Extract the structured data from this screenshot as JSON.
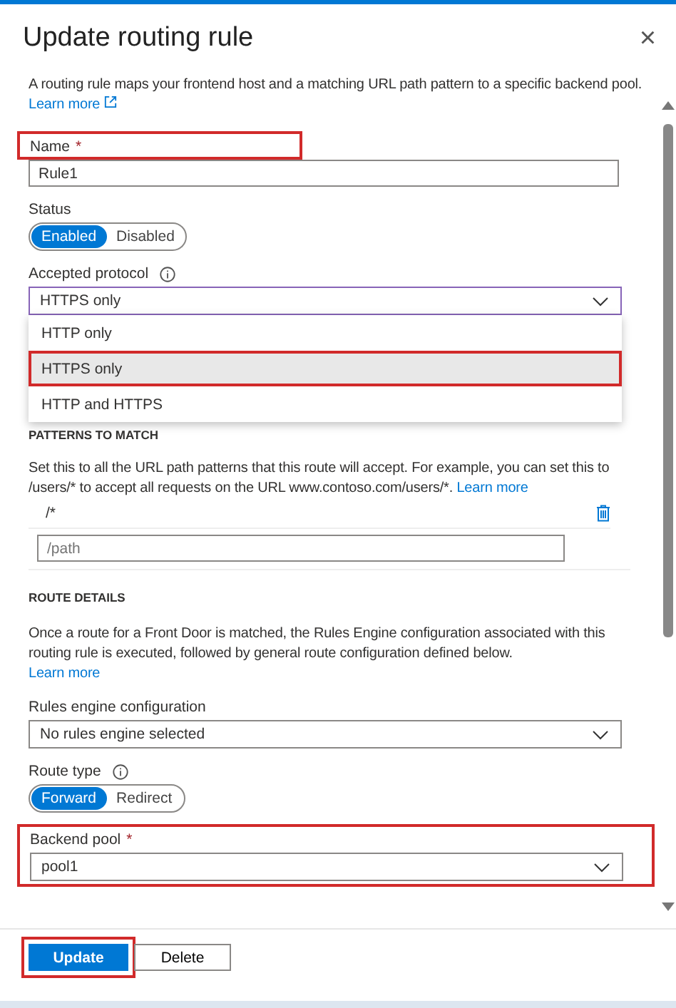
{
  "panel": {
    "title": "Update routing rule",
    "close_glyph": "×"
  },
  "intro": {
    "text": "A routing rule maps your frontend host and a matching URL path pattern to a specific backend pool.",
    "link": "Learn more"
  },
  "name_field": {
    "label": "Name",
    "required": "*",
    "value": "Rule1",
    "highlighted": true
  },
  "status": {
    "label": "Status",
    "options": [
      {
        "label": "Enabled",
        "selected": true
      },
      {
        "label": "Disabled",
        "selected": false
      }
    ]
  },
  "protocol": {
    "label": "Accepted protocol",
    "value": "HTTPS only",
    "options": [
      {
        "label": "HTTP only",
        "selected": false,
        "highlighted": false
      },
      {
        "label": "HTTPS only",
        "selected": true,
        "highlighted": true
      },
      {
        "label": "HTTP and HTTPS",
        "selected": false,
        "highlighted": false
      }
    ]
  },
  "patterns": {
    "heading": "PATTERNS TO MATCH",
    "text": "Set this to all the URL path patterns that this route will accept. For example, you can set this to /users/* to accept all requests on the URL www.contoso.com/users/*.",
    "link": "Learn more",
    "items": [
      "/*"
    ],
    "placeholder": "/path"
  },
  "route_details": {
    "heading": "ROUTE DETAILS",
    "text": "Once a route for a Front Door is matched, the Rules Engine configuration associated with this routing rule is executed, followed by general route configuration defined below.",
    "link": "Learn more"
  },
  "rules_engine": {
    "label": "Rules engine configuration",
    "value": "No rules engine selected"
  },
  "route_type": {
    "label": "Route type",
    "options": [
      {
        "label": "Forward",
        "selected": true
      },
      {
        "label": "Redirect",
        "selected": false
      }
    ]
  },
  "backend_pool": {
    "label": "Backend pool",
    "required": "*",
    "value": "pool1",
    "highlighted": true
  },
  "buttons": [
    {
      "label": "Update",
      "kind": "primary",
      "highlighted": true
    },
    {
      "label": "Delete",
      "kind": "secondary",
      "highlighted": false
    }
  ]
}
